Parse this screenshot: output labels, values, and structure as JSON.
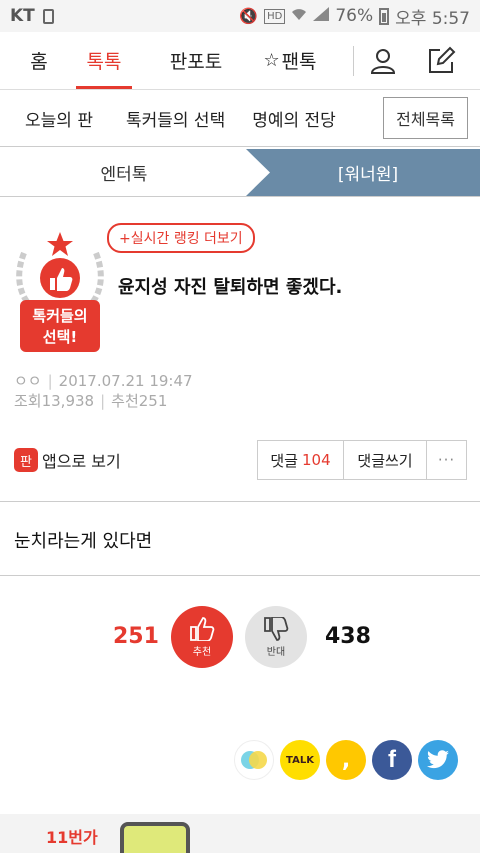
{
  "status_bar": {
    "carrier": "KT",
    "battery": "76%",
    "time": "오후 5:57",
    "hd": "HD"
  },
  "top_nav": {
    "tabs": [
      {
        "label": "홈"
      },
      {
        "label": "톡톡",
        "active": true
      },
      {
        "label": "판포토"
      },
      {
        "label": "팬톡"
      }
    ]
  },
  "sub_nav": {
    "items": [
      "오늘의 판",
      "톡커들의 선택",
      "명예의 전당"
    ],
    "all_button": "전체목록"
  },
  "category": {
    "left": "엔터톡",
    "right": "[워너원]"
  },
  "post": {
    "badge_text_1": "톡커들의",
    "badge_text_2": "선택!",
    "ranking_link": "+실시간 랭킹 더보기",
    "title": "윤지성 자진 탈퇴하면 좋겠다.",
    "author": "ㅇㅇ",
    "date": "2017.07.21 19:47",
    "views": "조회13,938",
    "recommends": "추천251",
    "body": "눈치라는게 있다면"
  },
  "actions": {
    "app_view": "앱으로 보기",
    "app_logo": "판",
    "comment_label": "댓글",
    "comment_count": "104",
    "write_label": "댓글쓰기",
    "more": "···"
  },
  "vote": {
    "up_count": "251",
    "up_label": "추천",
    "down_label": "반대",
    "down_count": "438"
  },
  "share": {
    "talk": "TALK",
    "story": ",",
    "facebook": "f"
  },
  "ad": {
    "brand": "11번가"
  },
  "colors": {
    "accent": "#e53a2f",
    "category_active": "#6a8ba7"
  }
}
